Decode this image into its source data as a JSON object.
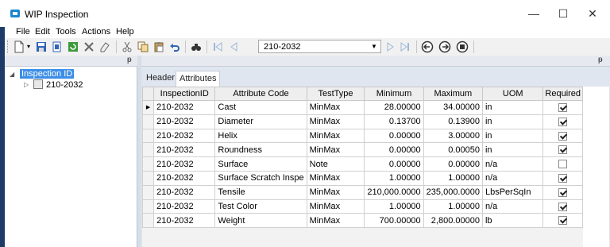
{
  "window": {
    "title": "WIP Inspection",
    "minimize_glyph": "—",
    "maximize_glyph": "☐",
    "close_glyph": "✕"
  },
  "menu": [
    "File",
    "Edit",
    "Tools",
    "Actions",
    "Help"
  ],
  "toolbar": {
    "icons": [
      "new-icon",
      "save-icon",
      "copy-record-icon",
      "refresh-icon",
      "delete-icon",
      "clear-icon",
      "cut-icon",
      "copy-icon",
      "paste-icon",
      "undo-icon",
      "find-icon",
      "first-record-icon",
      "previous-record-icon",
      "next-record-icon",
      "last-record-icon",
      "back-icon",
      "forward-icon",
      "stop-icon"
    ],
    "record_value": "210-2032"
  },
  "left_panel": {
    "pin_glyph": "ᵽ",
    "tree_root": "Inspection ID",
    "tree_child": "210-2032"
  },
  "right_panel": {
    "pin_glyph": "ᵽ",
    "tabs": [
      "Header",
      "Attributes"
    ],
    "active_tab": "Attributes"
  },
  "grid": {
    "columns": [
      "InspectionID",
      "Attribute Code",
      "TestType",
      "Minimum",
      "Maximum",
      "UOM",
      "Required"
    ],
    "rows": [
      {
        "id": "210-2032",
        "code": "Cast",
        "type": "MinMax",
        "min": "28.00000",
        "max": "34.00000",
        "uom": "in",
        "required": true
      },
      {
        "id": "210-2032",
        "code": "Diameter",
        "type": "MinMax",
        "min": "0.13700",
        "max": "0.13900",
        "uom": "in",
        "required": true
      },
      {
        "id": "210-2032",
        "code": "Helix",
        "type": "MinMax",
        "min": "0.00000",
        "max": "3.00000",
        "uom": "in",
        "required": true
      },
      {
        "id": "210-2032",
        "code": "Roundness",
        "type": "MinMax",
        "min": "0.00000",
        "max": "0.00050",
        "uom": "in",
        "required": true
      },
      {
        "id": "210-2032",
        "code": "Surface",
        "type": "Note",
        "min": "0.00000",
        "max": "0.00000",
        "uom": "n/a",
        "required": false
      },
      {
        "id": "210-2032",
        "code": "Surface Scratch Inspe",
        "type": "MinMax",
        "min": "1.00000",
        "max": "1.00000",
        "uom": "n/a",
        "required": true
      },
      {
        "id": "210-2032",
        "code": "Tensile",
        "type": "MinMax",
        "min": "210,000.0000",
        "max": "235,000.0000",
        "uom": "LbsPerSqIn",
        "required": true
      },
      {
        "id": "210-2032",
        "code": "Test Color",
        "type": "MinMax",
        "min": "1.00000",
        "max": "1.00000",
        "uom": "n/a",
        "required": true
      },
      {
        "id": "210-2032",
        "code": "Weight",
        "type": "MinMax",
        "min": "700.00000",
        "max": "2,800.00000",
        "uom": "lb",
        "required": true
      }
    ]
  },
  "colors": {
    "selection": "#3d8ee6",
    "panel_background": "#dfe6ef",
    "left_edge": "#1e3a67"
  }
}
